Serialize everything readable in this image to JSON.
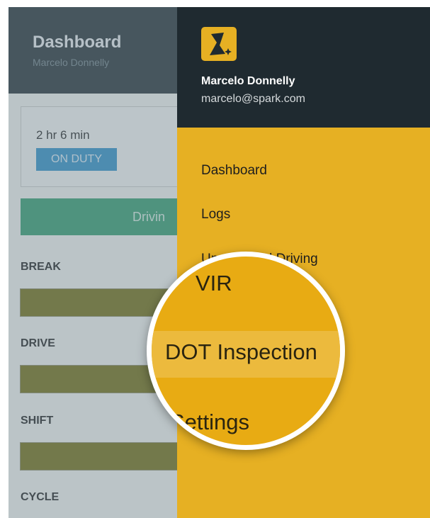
{
  "app": {
    "title": "Dashboard",
    "subtitle": "Marcelo Donnelly",
    "duty_time": "2 hr 6 min",
    "duty_status": "ON DUTY",
    "driving_button": "Drivin",
    "metrics": [
      "BREAK",
      "DRIVE",
      "SHIFT",
      "CYCLE"
    ]
  },
  "drawer": {
    "user_name": "Marcelo Donnelly",
    "user_email": "marcelo@spark.com",
    "items": [
      "Dashboard",
      "Logs",
      "Unassigned Driving"
    ]
  },
  "magnifier": {
    "item_vir": "VIR",
    "item_dot": "DOT Inspection",
    "item_settings": "Settings"
  },
  "colors": {
    "header": "#1f2a30",
    "drawer": "#e6b023",
    "on_duty_badge": "#2a8dc5",
    "driving_button": "#2f9a6a",
    "metric_bar": "#6f6a0e"
  },
  "icons": {
    "logo": "spark-logo-icon"
  }
}
